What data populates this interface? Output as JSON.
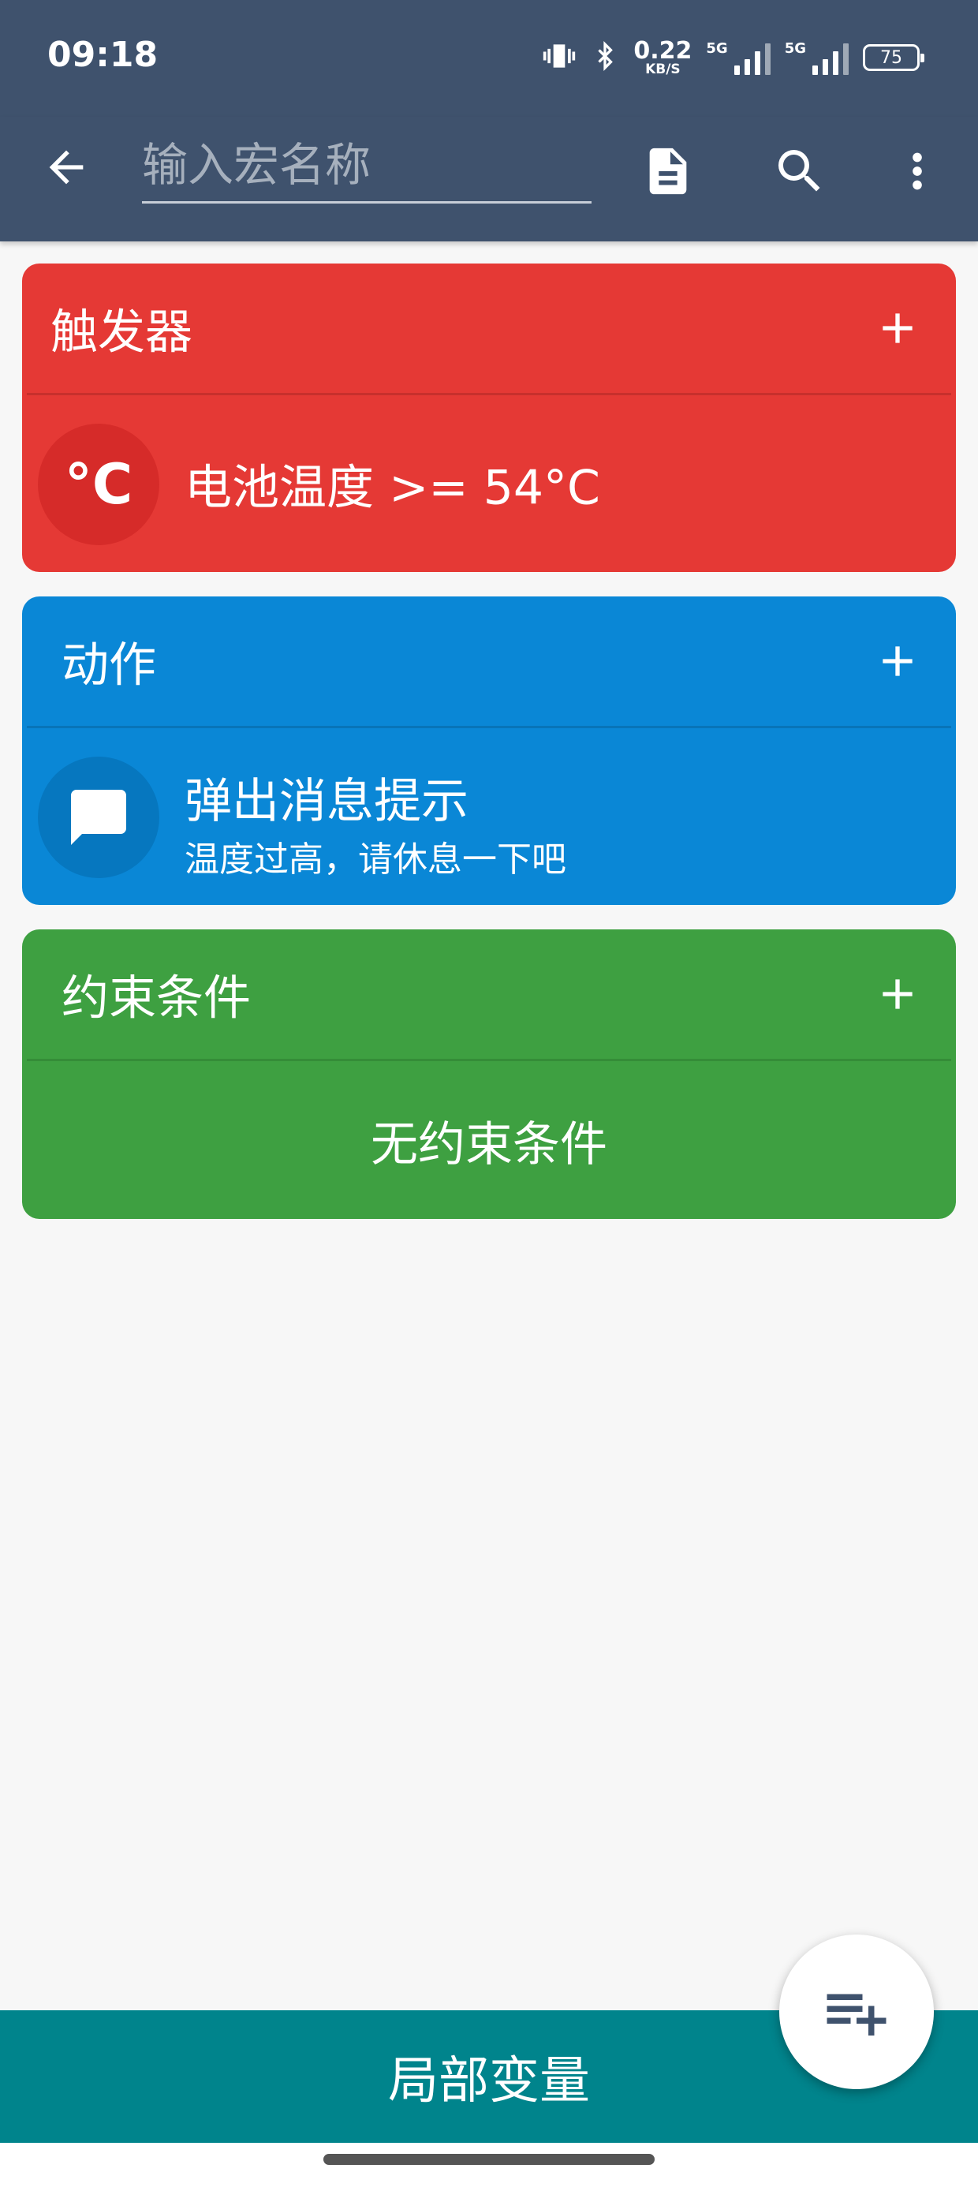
{
  "status_bar": {
    "time": "09:18",
    "net_speed_value": "0.22",
    "net_speed_unit": "KB/S",
    "sim1_label": "5G",
    "sim2_label": "5G",
    "battery": "75"
  },
  "app_bar": {
    "name_placeholder": "输入宏名称",
    "name_value": ""
  },
  "trigger": {
    "title": "触发器",
    "item": {
      "icon": "°C",
      "text": "电池温度 >= 54°C"
    }
  },
  "action": {
    "title": "动作",
    "item": {
      "title": "弹出消息提示",
      "subtitle": "温度过高，请休息一下吧"
    }
  },
  "constraint": {
    "title": "约束条件",
    "empty_text": "无约束条件"
  },
  "bottom_bar": {
    "label": "局部变量"
  },
  "colors": {
    "app_bar": "#3f526d",
    "trigger": "#e53935",
    "action": "#0a87d6",
    "constraint": "#3ea041",
    "bottom_bar": "#00848c"
  }
}
